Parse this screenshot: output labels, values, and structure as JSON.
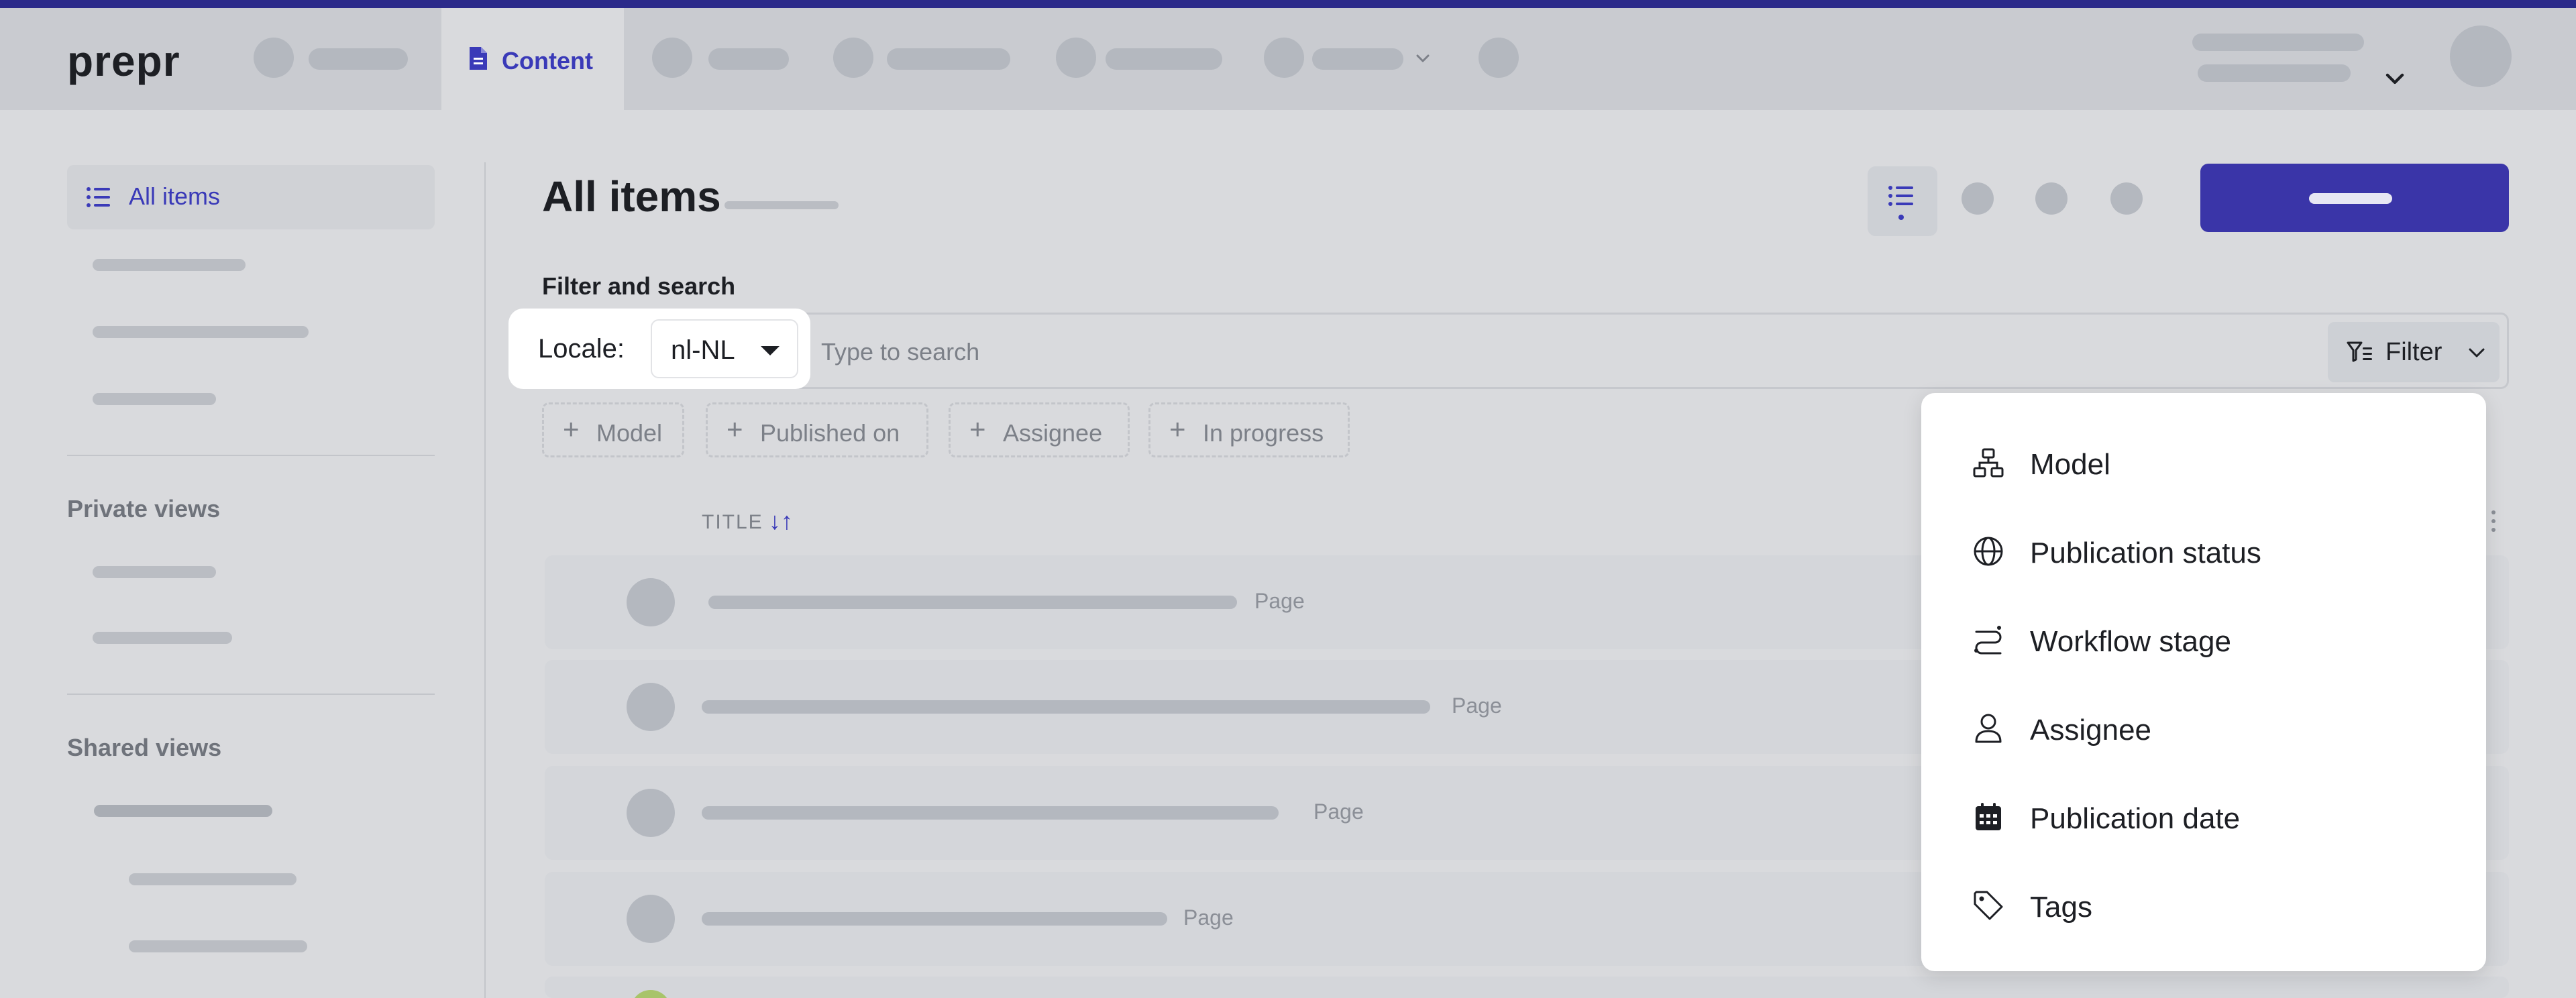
{
  "app": {
    "logo": "prepr"
  },
  "topnav": {
    "active_tab": "Content"
  },
  "sidebar": {
    "active_item": "All items",
    "private_views_heading": "Private views",
    "shared_views_heading": "Shared views"
  },
  "main": {
    "title": "All items",
    "filter_heading": "Filter and search",
    "locale_label": "Locale:",
    "locale_value": "nl-NL",
    "search_placeholder": "Type to search",
    "filter_button": "Filter",
    "chips": [
      "Model",
      "Published on",
      "Assignee",
      "In progress"
    ],
    "column_title": "TITLE",
    "sort_icon": "↓↑",
    "rows": [
      {
        "type": "Page"
      },
      {
        "type": "Page"
      },
      {
        "type": "Page"
      },
      {
        "type": "Page"
      }
    ]
  },
  "filter_menu": {
    "items": [
      {
        "label": "Model",
        "icon": "model-icon"
      },
      {
        "label": "Publication status",
        "icon": "globe-icon"
      },
      {
        "label": "Workflow stage",
        "icon": "workflow-icon"
      },
      {
        "label": "Assignee",
        "icon": "user-icon"
      },
      {
        "label": "Publication date",
        "icon": "calendar-icon"
      },
      {
        "label": "Tags",
        "icon": "tag-icon"
      }
    ]
  },
  "colors": {
    "accent": "#3a3ab8",
    "primary_button": "#3a35a8",
    "top_line": "#2b2a8a"
  }
}
